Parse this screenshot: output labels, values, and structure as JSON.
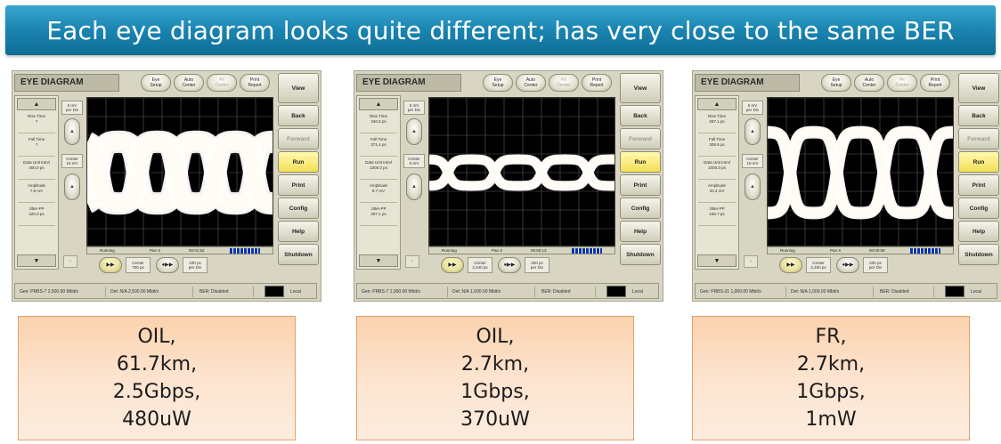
{
  "slide": {
    "title": "Each eye diagram looks quite different; has very close to the same BER"
  },
  "app": {
    "title": "EYE DIAGRAM",
    "top_buttons": [
      {
        "label": "Eye\nSetup",
        "enabled": true
      },
      {
        "label": "Auto\nCenter",
        "enabled": true
      },
      {
        "label": "Fit\nCenter",
        "enabled": false
      },
      {
        "label": "Print\nReport",
        "enabled": true
      }
    ],
    "side_buttons": [
      "View",
      "Back",
      "Forward",
      "Run",
      "Print",
      "Config",
      "Help",
      "Shutdown"
    ],
    "status_running": "Running",
    "status_pan": "Pan X",
    "volt_per_div": "5 mV\nper Div",
    "eye_colors": [
      "#ffffff",
      "#ffd35a",
      "#ff7a1a",
      "#d0122e",
      "#a6158a",
      "#3d2bd6",
      "#1ea04a"
    ]
  },
  "panels": [
    {
      "measurements": [
        "Rise Time\n?",
        "Fall Time\n?",
        "Data Unit Intrvl\n400.0 ps",
        "Amplitude\n7.9 mV",
        "Jitter-PP\n420.0 ps"
      ],
      "center_v": "Center\n19 mV",
      "time": "00:01:52",
      "center_time": "Center\n700 ps",
      "time_per_div": "100 ps\nper Div",
      "gen": "Gen: PRBS-7 2,500.00 Mbit/s",
      "det": "Det: N/A 2,500.00 Mbit/s",
      "ber": "BER: Disabled",
      "local": "Local",
      "caption_lines": [
        "OIL,",
        "61.7km,",
        "2.5Gbps,",
        "480uW"
      ]
    },
    {
      "measurements": [
        "Rise Time\n340.6 ps",
        "Fall Time\n371.4 ps",
        "Data Unit Intrvl\n1000.0 ps",
        "Amplitude\n8.7 mV",
        "Jitter-PP\n297.1 ps"
      ],
      "center_v": "Center\n9 mV",
      "time": "00:00:13",
      "center_time": "Center\n2,440 ps",
      "time_per_div": "200 ps\nper Div",
      "gen": "Gen: PRBS-7 1,000.00 Mbit/s",
      "det": "Det: N/A 1,000.00 Mbit/s",
      "ber": "BER: Disabled",
      "local": "Local",
      "caption_lines": [
        "OIL,",
        "2.7km,",
        "1Gbps,",
        "370uW"
      ]
    },
    {
      "measurements": [
        "Rise Time\n297.1 ps",
        "Fall Time\n308.6 ps",
        "Data Unit Intrvl\n1000.0 ps",
        "Amplitude\n20.4 mV",
        "Jitter-PP\n165.7 ps"
      ],
      "center_v": "Center\n19 mV",
      "time": "00:00:09",
      "center_time": "Center\n2,450 ps",
      "time_per_div": "200 ps\nper Div",
      "gen": "Gen: PRBS-31 1,000.00 Mbit/s",
      "det": "Det: N/A 1,000.00 Mbit/s",
      "ber": "BER: Disabled",
      "local": "Local",
      "caption_lines": [
        "FR,",
        "2.7km,",
        "1Gbps,",
        "1mW"
      ]
    }
  ]
}
